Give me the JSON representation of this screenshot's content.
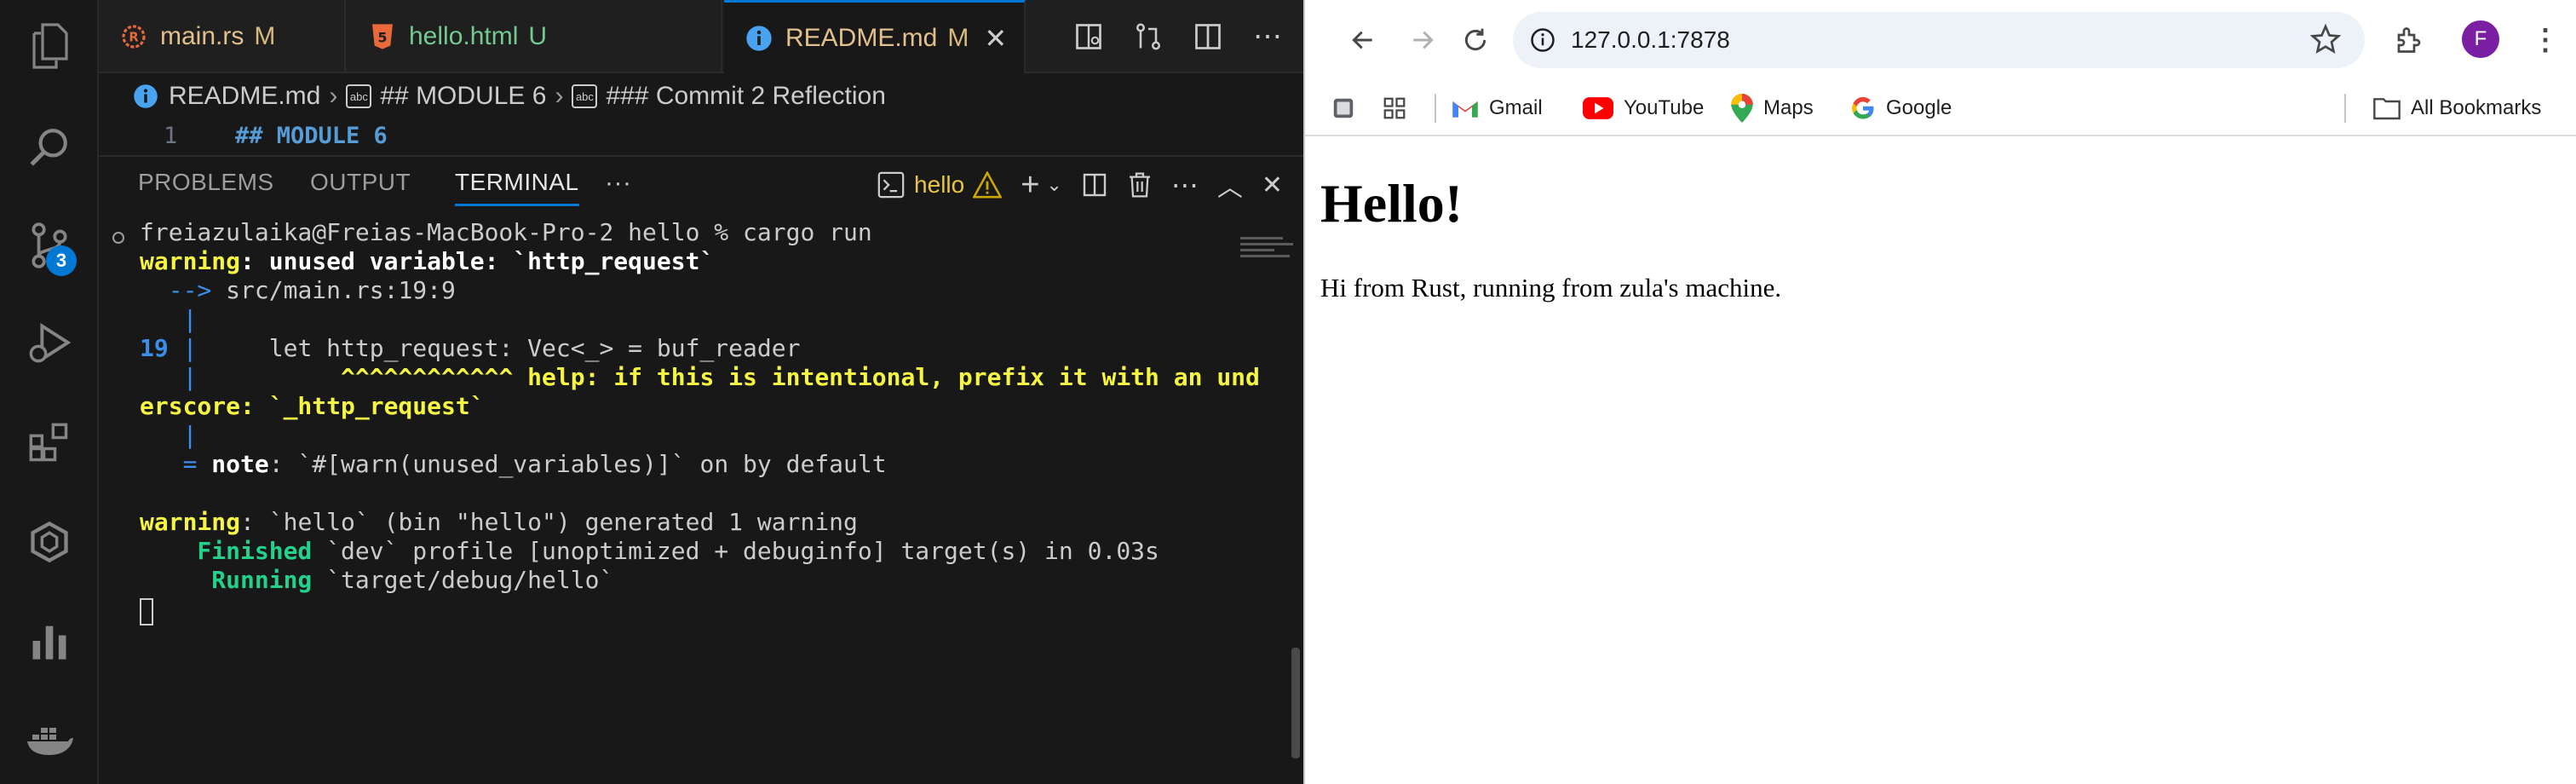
{
  "vscode": {
    "tabs": [
      {
        "label": "main.rs",
        "status": "M",
        "status_color": "#d7ba7d",
        "icon": "rust-file-icon"
      },
      {
        "label": "hello.html",
        "status": "U",
        "status_color": "#73c991",
        "icon": "html5-file-icon"
      },
      {
        "label": "README.md",
        "status": "M",
        "status_color": "#d7ba7d",
        "icon": "info-file-icon",
        "active": true
      }
    ],
    "breadcrumb": [
      "README.md",
      "## MODULE 6",
      "### Commit 2 Reflection"
    ],
    "editor": {
      "line_number": "1",
      "line_text": "## MODULE 6"
    },
    "activity_badge": "3",
    "panel_tabs": [
      "PROBLEMS",
      "OUTPUT",
      "TERMINAL"
    ],
    "panel_more": "···",
    "terminal_name": "hello",
    "terminal": {
      "prompt": "freiazulaika@Freias-MacBook-Pro-2 hello % cargo run",
      "warning_kw": "warning",
      "warning_msg": ": unused variable: `http_request`",
      "arrow": "  -->",
      "location": " src/main.rs:19:9",
      "pipe": "   |",
      "code_line_num": "19",
      "code_line_pipe": " |",
      "code_line": "     let http_request: Vec<_> = buf_reader",
      "carets": "          ^^^^^^^^^^^^",
      "help_text": " help: if this is intentional, prefix it with an und",
      "help_wrap": "erscore: `_http_request`",
      "note_eq": "   =",
      "note_kw": " note",
      "note_msg": ": `#[warn(unused_variables)]` on by default",
      "warning2_kw": "warning",
      "warning2_msg": ": `hello` (bin \"hello\") generated 1 warning",
      "finished_kw": "    Finished",
      "finished_msg": " `dev` profile [unoptimized + debuginfo] target(s) in 0.03s",
      "running_kw": "     Running",
      "running_msg": " `target/debug/hello`"
    }
  },
  "chrome": {
    "url": "127.0.0.1:7878",
    "avatar_letter": "F",
    "bookmarks": [
      "Gmail",
      "YouTube",
      "Maps",
      "Google"
    ],
    "all_bookmarks": "All Bookmarks",
    "page": {
      "heading": "Hello!",
      "paragraph": "Hi from Rust, running from zula's machine."
    }
  },
  "colors": {
    "accent": "#0078d4",
    "warning": "#f5f543",
    "success": "#23d18b"
  }
}
